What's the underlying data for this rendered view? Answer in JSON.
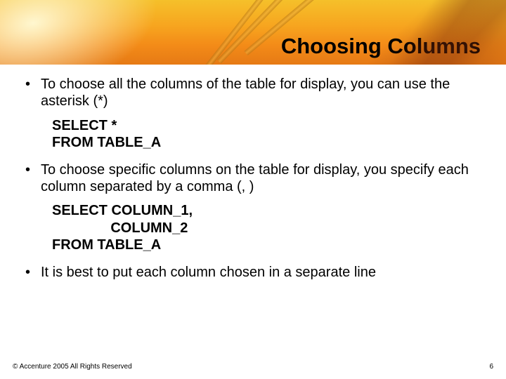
{
  "header": {
    "title": "Choosing Columns"
  },
  "bullets": [
    "To choose all the columns of the table for display, you can use the asterisk (*)",
    "To choose specific columns on the table for display, you specify each column separated by a comma (, )",
    "It is best to put each column chosen in a separate line"
  ],
  "code": {
    "block1": "SELECT *\nFROM TABLE_A",
    "block2": "SELECT COLUMN_1,\n               COLUMN_2\nFROM TABLE_A"
  },
  "footer": {
    "copyright": "© Accenture 2005 All Rights Reserved",
    "page": "6"
  }
}
